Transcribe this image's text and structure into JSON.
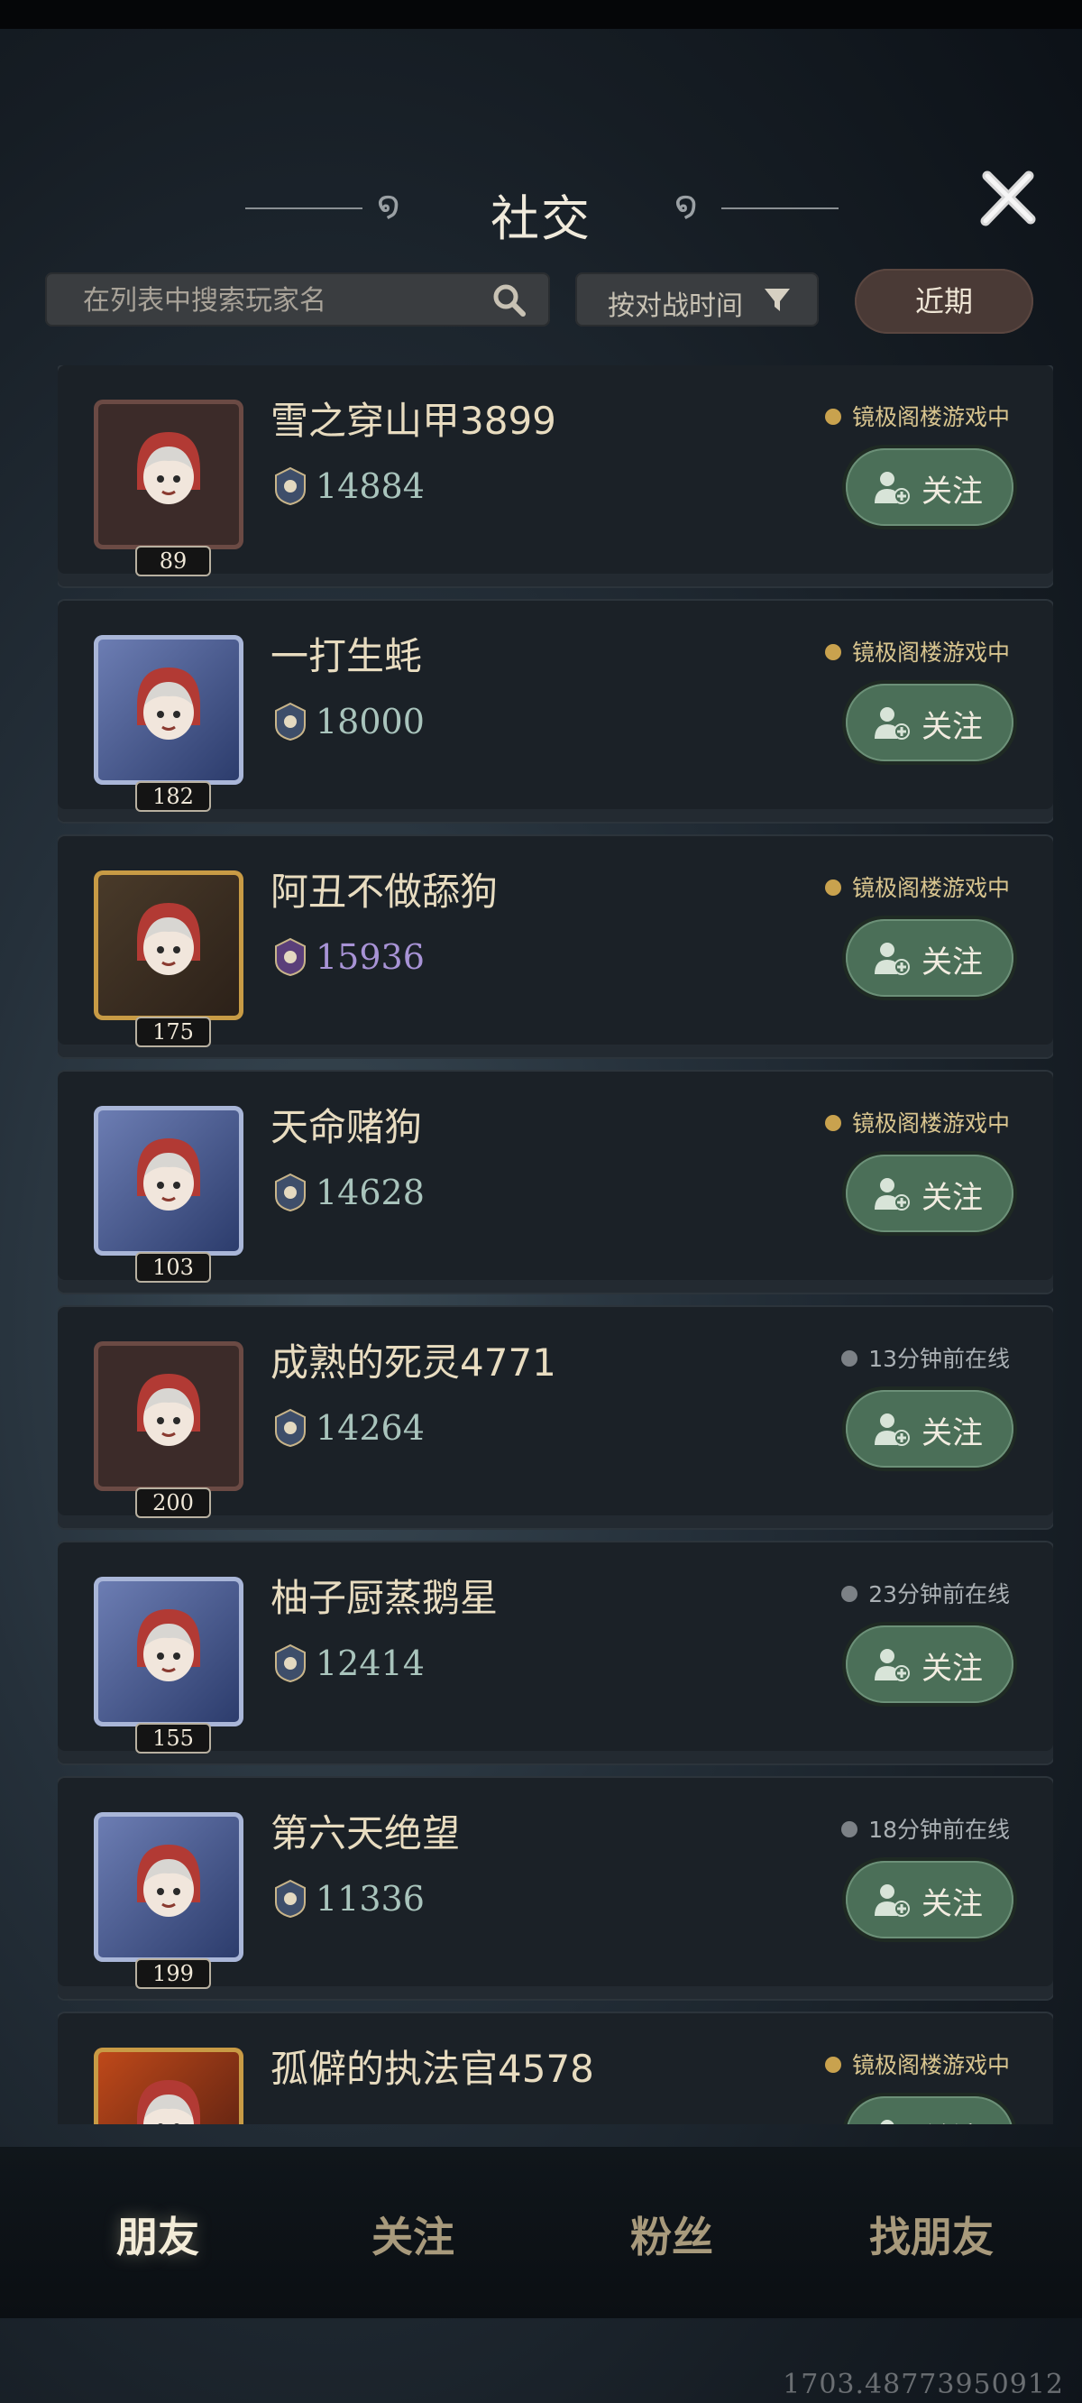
{
  "header": {
    "title": "社交"
  },
  "search": {
    "placeholder": "在列表中搜索玩家名"
  },
  "sort": {
    "label": "按对战时间"
  },
  "recent_label": "近期",
  "follow_label": "关注",
  "players": [
    {
      "name": "雪之穿山甲3899",
      "level": "89",
      "score": "14884",
      "status": "镜极阁楼游戏中",
      "online": true,
      "avatar": "plain",
      "score_color": "green"
    },
    {
      "name": "一打生蚝",
      "level": "182",
      "score": "18000",
      "status": "镜极阁楼游戏中",
      "online": true,
      "avatar": "frame-blue",
      "score_color": "green"
    },
    {
      "name": "阿丑不做舔狗",
      "level": "175",
      "score": "15936",
      "status": "镜极阁楼游戏中",
      "online": true,
      "avatar": "frame-gold",
      "score_color": "purple"
    },
    {
      "name": "天命赌狗",
      "level": "103",
      "score": "14628",
      "status": "镜极阁楼游戏中",
      "online": true,
      "avatar": "frame-blue",
      "score_color": "green"
    },
    {
      "name": "成熟的死灵4771",
      "level": "200",
      "score": "14264",
      "status": "13分钟前在线",
      "online": false,
      "avatar": "plain",
      "score_color": "green"
    },
    {
      "name": "柚子厨蒸鹅星",
      "level": "155",
      "score": "12414",
      "status": "23分钟前在线",
      "online": false,
      "avatar": "frame-blue",
      "score_color": "green"
    },
    {
      "name": "第六天绝望",
      "level": "199",
      "score": "11336",
      "status": "18分钟前在线",
      "online": false,
      "avatar": "frame-blue",
      "score_color": "green"
    },
    {
      "name": "孤僻的执法官4578",
      "level": "",
      "score": "",
      "status": "镜极阁楼游戏中",
      "online": true,
      "avatar": "frame-red",
      "score_color": "green"
    }
  ],
  "tabs": [
    "朋友",
    "关注",
    "粉丝",
    "找朋友"
  ],
  "active_tab": "朋友",
  "footer_number": "1703.48773950912",
  "colors": {
    "follow_button": "#4b6f58",
    "online_dot": "#c9a24e",
    "offline_dot": "#7c8186",
    "card": "#1b2127"
  }
}
